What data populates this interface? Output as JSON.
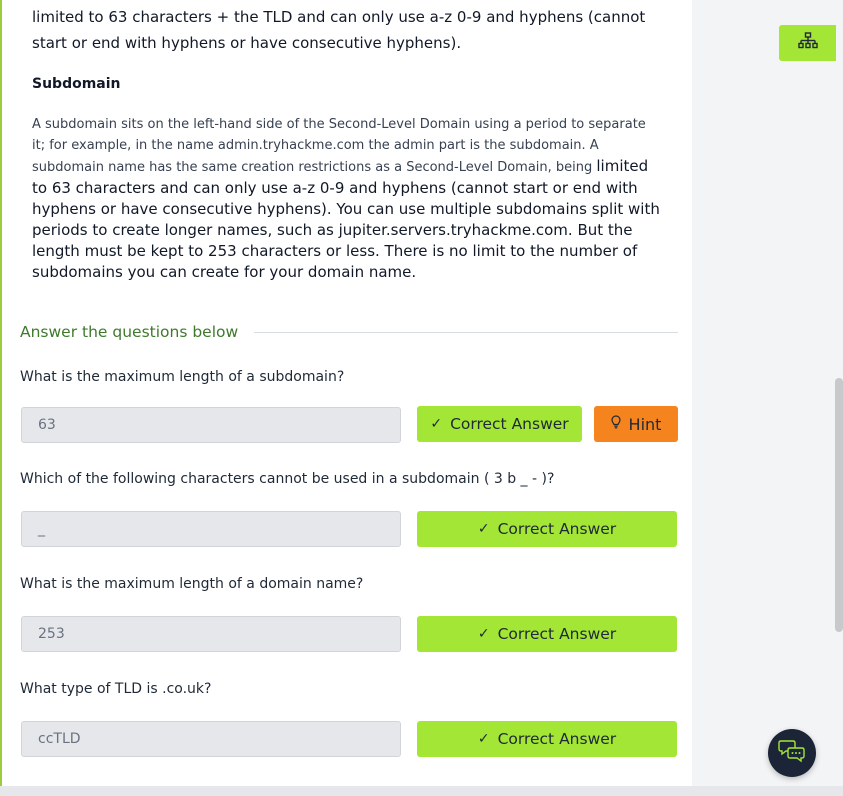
{
  "content": {
    "para_top": "limited to 63 characters + the TLD and can only use a-z 0-9 and hyphens (cannot start or end with hyphens or have consecutive hyphens).",
    "subhead": "Subdomain",
    "para_part1": "A subdomain sits on the left-hand side of the Second-Level Domain using a period to separate it; for example, in the name admin.tryhackme.com the admin part is the subdomain. A subdomain name has the same creation restrictions as a Second-Level Domain, being ",
    "para_part2": "limited to 63 characters and can only use a-z 0-9 and hyphens (cannot start or end with hyphens or have consecutive hyphens). You can use multiple subdomains split with periods to create longer names, such as jupiter.servers.tryhackme.com. But the length must be kept to 253 characters or less. There is no limit to the number of subdomains you can create for your domain name."
  },
  "answers_heading": "Answer the questions below",
  "questions": [
    {
      "text": "What is the maximum length of a subdomain?",
      "answer": "63"
    },
    {
      "text": "Which of the following characters cannot be used in a subdomain ( 3 b _ - )?",
      "answer": "_"
    },
    {
      "text": "What is the maximum length of a domain name?",
      "answer": "253"
    },
    {
      "text": "What type of TLD is .co.uk?",
      "answer": "ccTLD"
    }
  ],
  "buttons": {
    "correct_label": "Correct Answer",
    "hint_label": "Hint"
  },
  "icons": {
    "check": "check-icon",
    "hint": "lightbulb-icon",
    "sitemap": "sitemap-icon",
    "chat": "chat-bubbles-icon"
  },
  "colors": {
    "accent_green": "#a3e635",
    "hint_orange": "#f5841f",
    "heading_green": "#3f7a2c",
    "fab_dark": "#1c2538"
  }
}
